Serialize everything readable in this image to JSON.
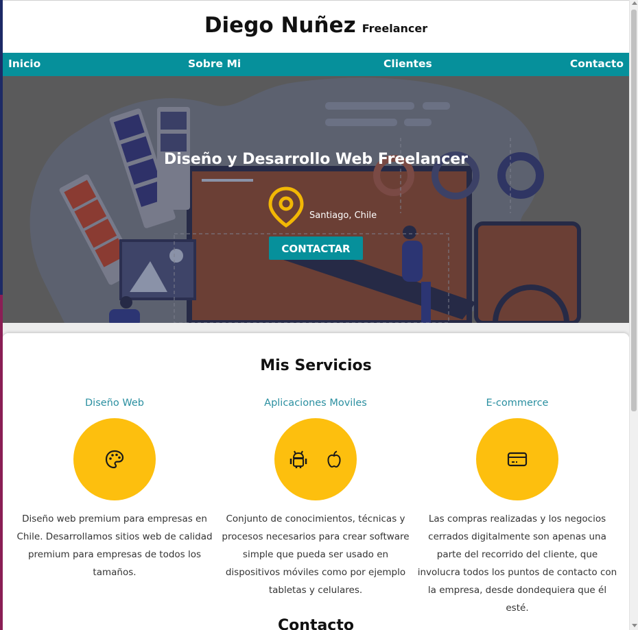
{
  "header": {
    "name": "Diego Nuñez",
    "tagline": "Freelancer"
  },
  "nav": {
    "items": [
      {
        "label": "Inicio"
      },
      {
        "label": "Sobre Mi"
      },
      {
        "label": "Clientes"
      },
      {
        "label": "Contacto"
      }
    ]
  },
  "hero": {
    "title": "Diseño y Desarrollo Web Freelancer",
    "location_icon": "map-pin-icon",
    "location": "Santiago, Chile",
    "cta_label": "CONTACTAR"
  },
  "services": {
    "title": "Mis Servicios",
    "items": [
      {
        "title": "Diseño Web",
        "icon": "palette-icon",
        "description": "Diseño web premium para empresas en Chile. Desarrollamos sitios web de calidad premium para empresas de todos los tamaños."
      },
      {
        "title": "Aplicaciones Moviles",
        "icons": [
          "android-icon",
          "apple-icon"
        ],
        "description": "Conjunto de conocimientos, técnicas y procesos necesarios para crear software simple que pueda ser usado en dispositivos móviles como por ejemplo tabletas y celulares."
      },
      {
        "title": "E-commerce",
        "icon": "credit-card-icon",
        "description": "Las compras realizadas y los negocios cerrados digitalmente son apenas una parte del recorrido del cliente, que involucra todos los puntos de contacto con la empresa, desde dondequiera que él esté."
      }
    ]
  },
  "contact": {
    "title": "Contacto"
  },
  "colors": {
    "accent": "#06909b",
    "service_circle": "#fdbf0e",
    "service_title": "#2a8fa0",
    "location_pin": "#f2b705"
  }
}
